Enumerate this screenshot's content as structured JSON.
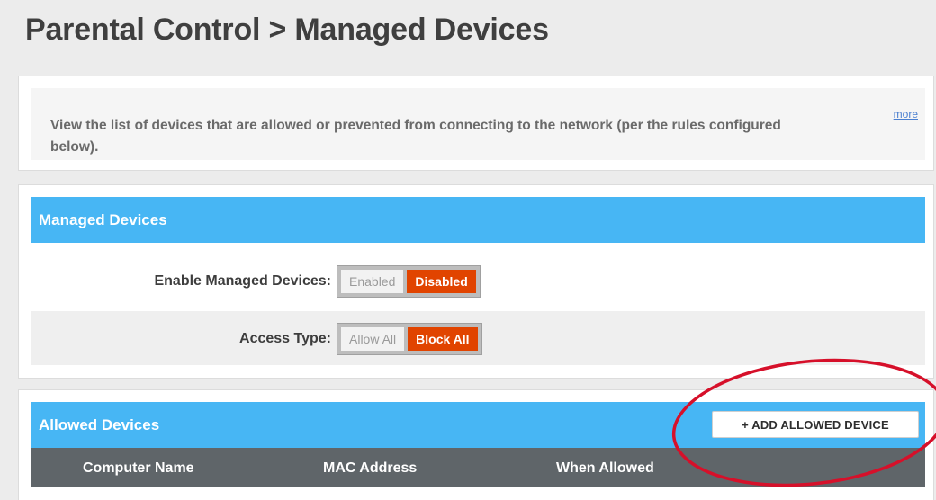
{
  "page": {
    "title": "Parental Control > Managed Devices"
  },
  "info": {
    "text": "View the list of devices that are allowed or prevented from connecting to the network (per the rules configured below).",
    "more_link": "more"
  },
  "managed_devices": {
    "header": "Managed Devices",
    "enable_label": "Enable Managed Devices:",
    "enable_options": [
      "Enabled",
      "Disabled"
    ],
    "enable_selected": "Disabled",
    "access_label": "Access Type:",
    "access_options": [
      "Allow All",
      "Block All"
    ],
    "access_selected": "Block All"
  },
  "allowed_devices": {
    "header": "Allowed Devices",
    "add_button": "+ ADD ALLOWED DEVICE",
    "columns": [
      "Computer Name",
      "MAC Address",
      "When Allowed"
    ]
  },
  "colors": {
    "accent_blue": "#47b6f4",
    "selected_orange": "#e14400",
    "annotation_red": "#d6102a",
    "column_header": "#5f6569"
  }
}
